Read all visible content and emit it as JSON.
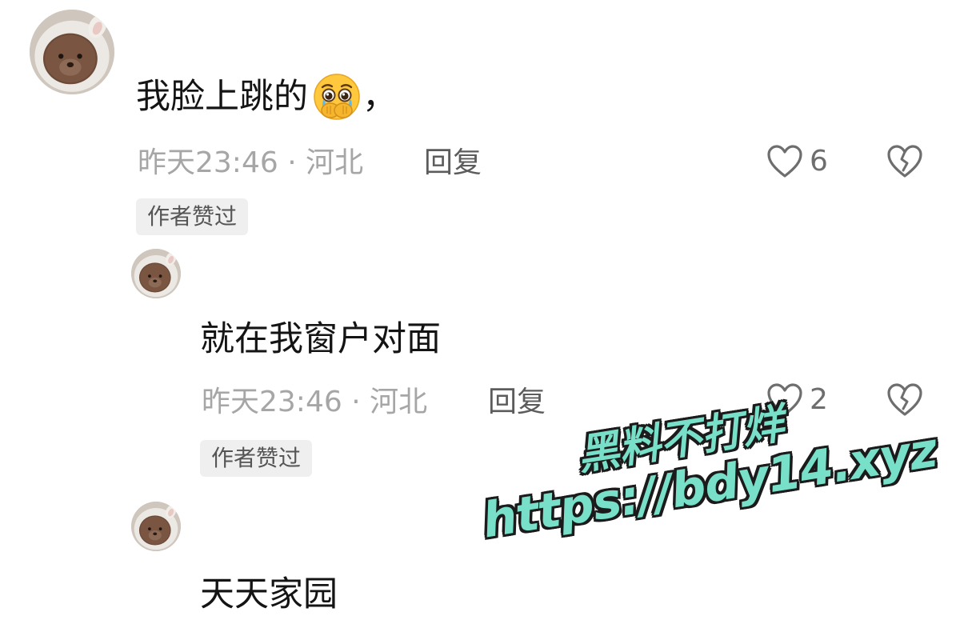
{
  "comments": [
    {
      "text": "我脸上跳的",
      "emoji": "pleading-face-hands-over-mouth-emoji",
      "trailing": "，",
      "time": "昨天23:46",
      "separator": "·",
      "location": "河北",
      "reply_label": "回复",
      "likes": "6",
      "badge": "作者赞过"
    },
    {
      "text": "就在我窗户对面",
      "time": "昨天23:46",
      "separator": "·",
      "location": "河北",
      "reply_label": "回复",
      "likes": "2",
      "badge": "作者赞过"
    },
    {
      "text": "天天家园"
    }
  ],
  "watermark": {
    "line1": "黑料不打烊",
    "line2": "https://bdy14.xyz"
  },
  "colors": {
    "meta_gray": "#a6a6a6",
    "badge_bg": "#efefef",
    "watermark_fill": "#78e0c8"
  }
}
